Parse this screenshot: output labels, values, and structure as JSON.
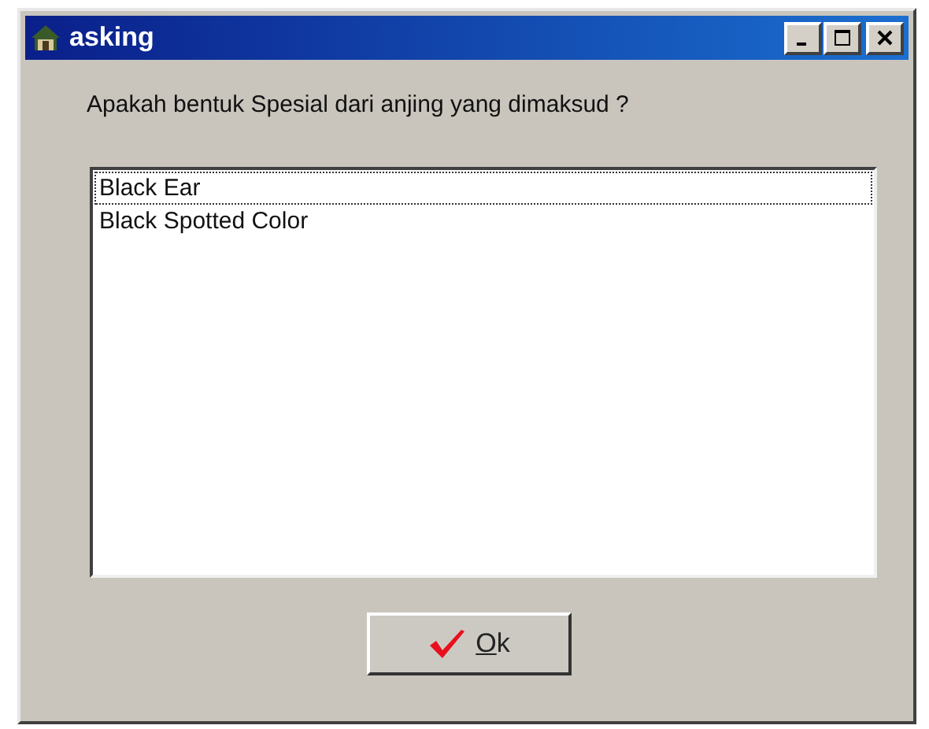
{
  "window": {
    "title": "asking"
  },
  "question": "Apakah bentuk Spesial dari anjing yang dimaksud ?",
  "options": [
    {
      "label": "Black Ear",
      "focused": true
    },
    {
      "label": "Black Spotted Color",
      "focused": false
    }
  ],
  "button": {
    "label": "Ok"
  }
}
